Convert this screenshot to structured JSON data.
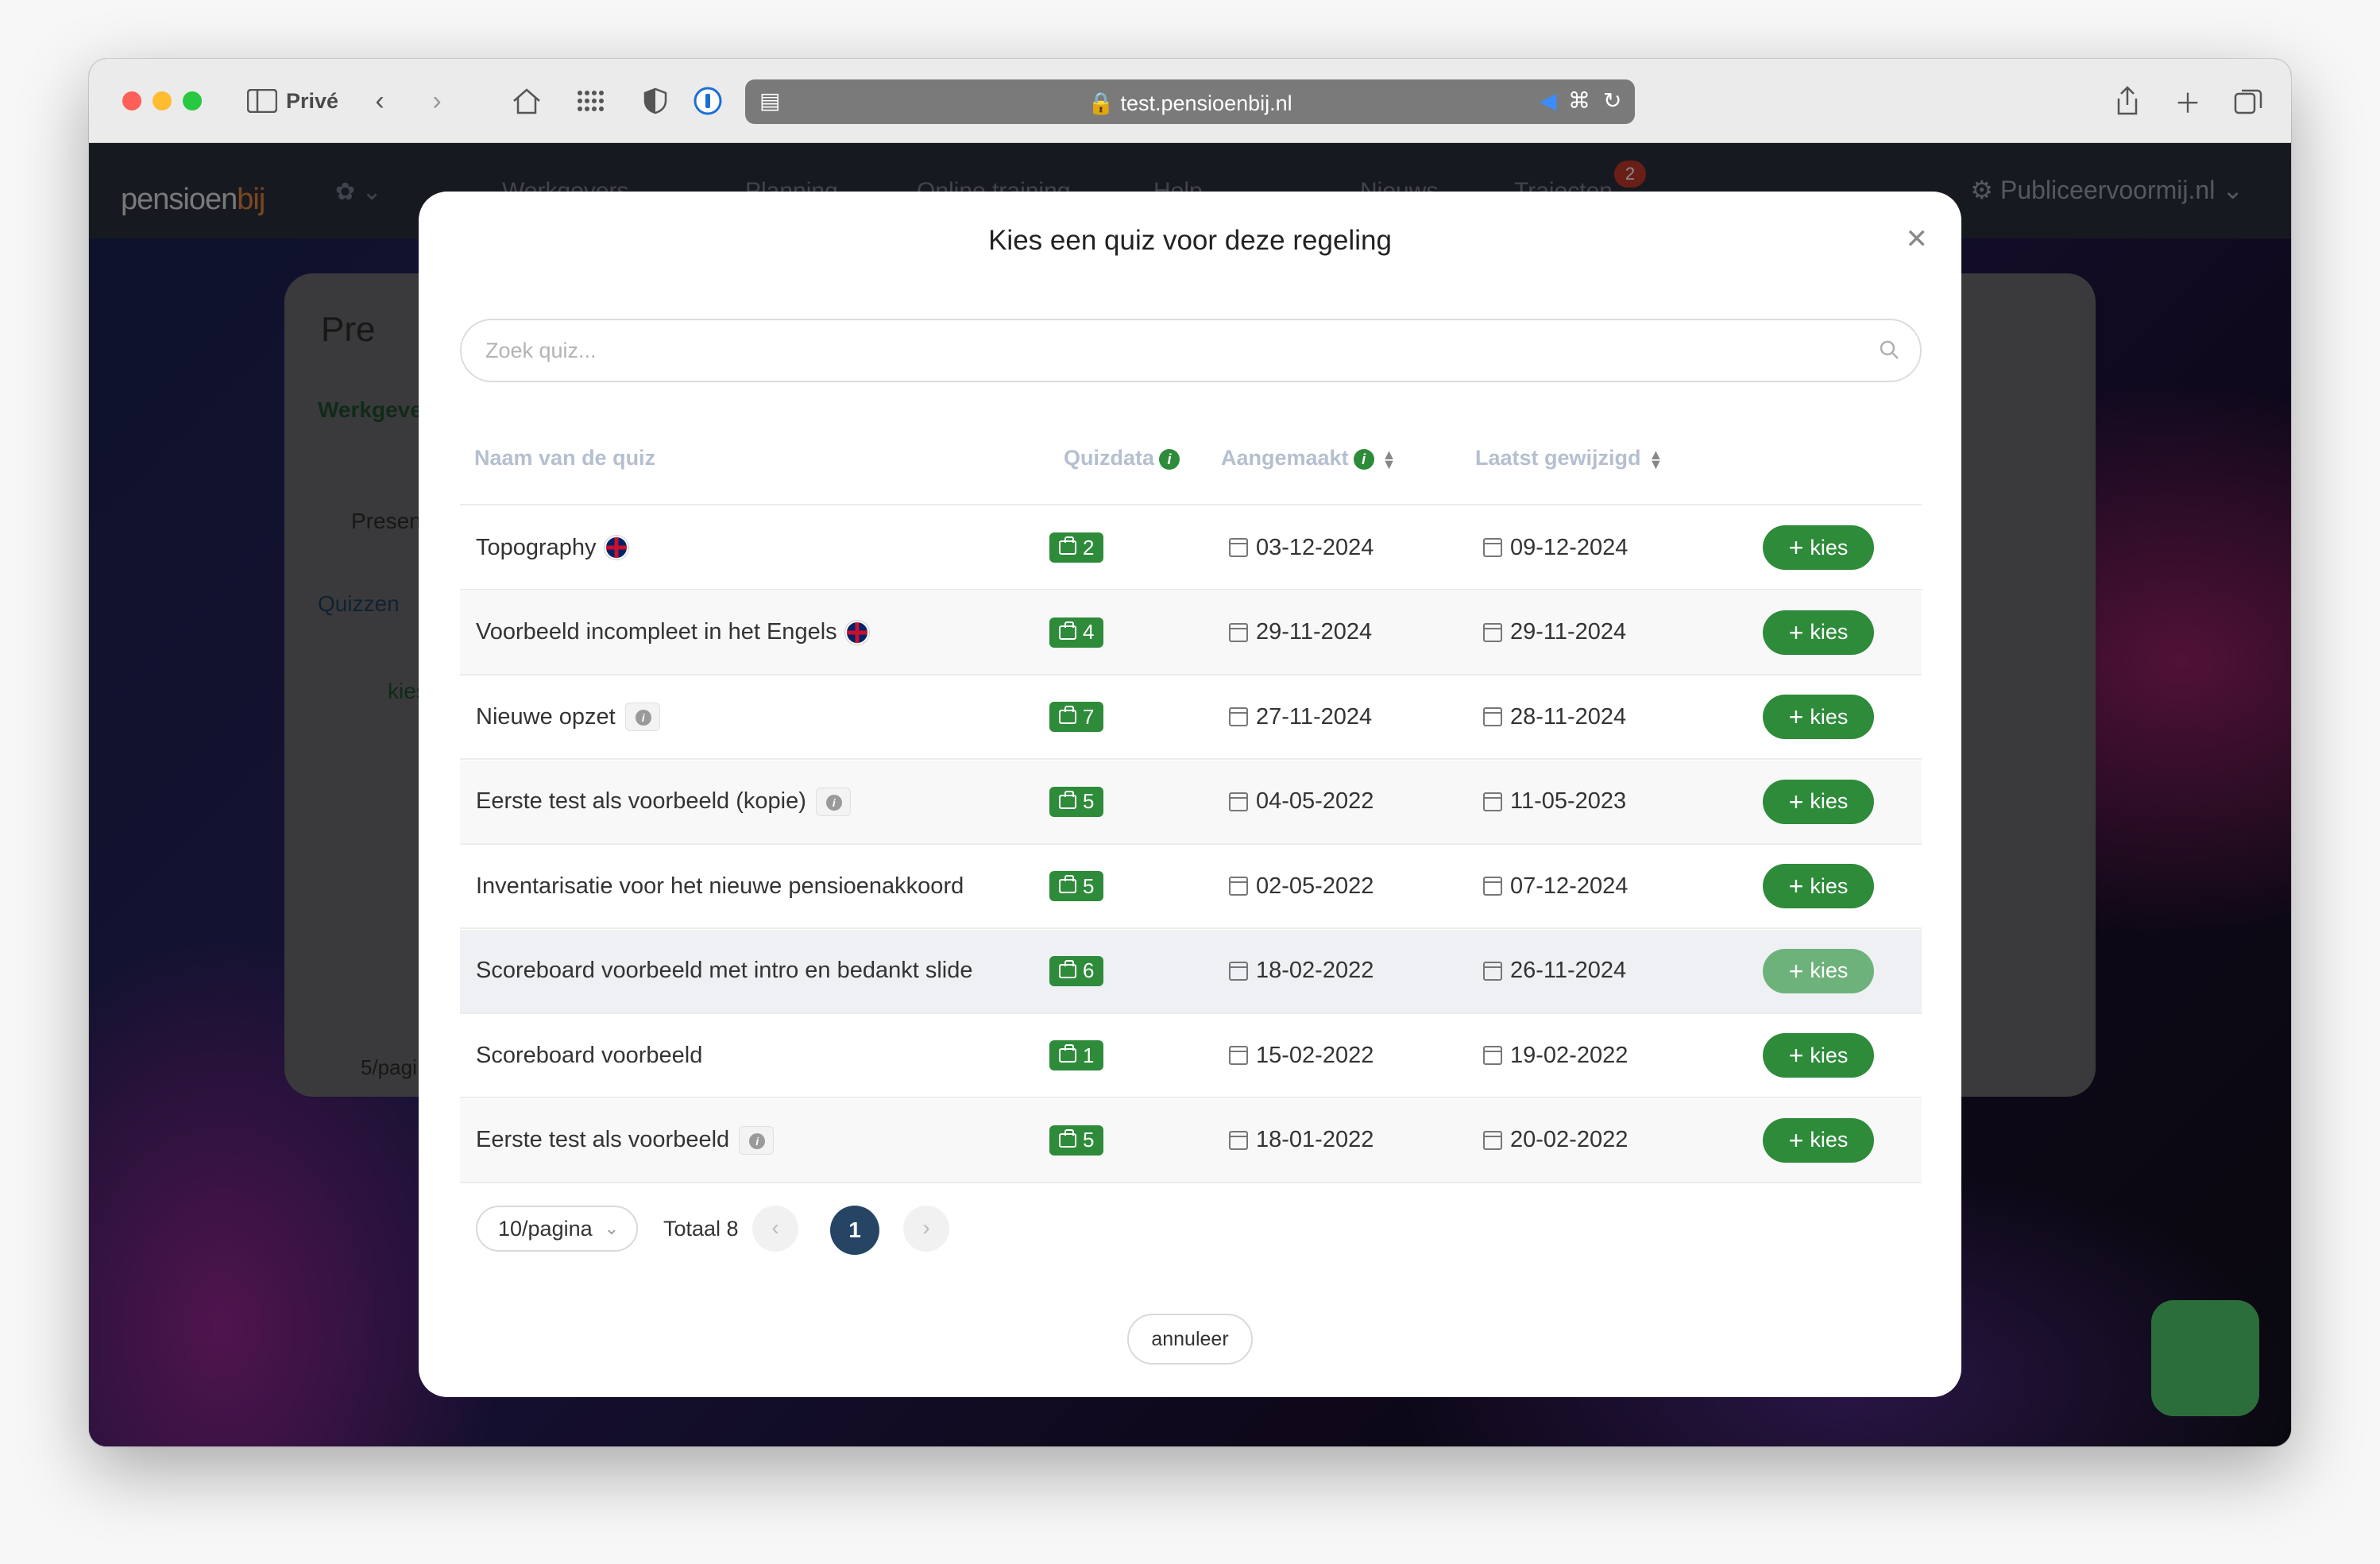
{
  "browser": {
    "profile_label": "Privé",
    "url": "test.pensioenbij.nl"
  },
  "app": {
    "logo_main": "pensioen",
    "logo_accent": "bij",
    "nav_items": [
      "Werkgevers",
      "Planning",
      "Online training",
      "Help",
      "Nieuws",
      "Trajecten"
    ],
    "notification_count": "2",
    "org_label": "Publiceervoormij.nl"
  },
  "background": {
    "title": "Pre",
    "werkgever_label": "Werkgeve",
    "presen_label": "Presen",
    "quizzen_tab": "Quizzen",
    "kies_label": "kies",
    "per_page": "5/pagi"
  },
  "modal": {
    "title": "Kies een quiz voor deze regeling",
    "search_placeholder": "Zoek quiz...",
    "columns": {
      "name": "Naam van de quiz",
      "quizdata": "Quizdata",
      "aangemaakt": "Aangemaakt",
      "laatst": "Laatst gewijzigd"
    },
    "rows": [
      {
        "name": "Topography",
        "count": "2",
        "created": "03-12-2024",
        "modified": "09-12-2024"
      },
      {
        "name": "Voorbeeld incompleet in het Engels",
        "count": "4",
        "created": "29-11-2024",
        "modified": "29-11-2024"
      },
      {
        "name": "Nieuwe opzet",
        "count": "7",
        "created": "27-11-2024",
        "modified": "28-11-2024"
      },
      {
        "name": "Eerste test als voorbeeld (kopie)",
        "count": "5",
        "created": "04-05-2022",
        "modified": "11-05-2023"
      },
      {
        "name": "Inventarisatie voor het nieuwe pensioenakkoord",
        "count": "5",
        "created": "02-05-2022",
        "modified": "07-12-2024"
      },
      {
        "name": "Scoreboard voorbeeld met intro en bedankt slide",
        "count": "6",
        "created": "18-02-2022",
        "modified": "26-11-2024"
      },
      {
        "name": "Scoreboard voorbeeld",
        "count": "1",
        "created": "15-02-2022",
        "modified": "19-02-2022"
      },
      {
        "name": "Eerste test als voorbeeld",
        "count": "5",
        "created": "18-01-2022",
        "modified": "20-02-2022"
      }
    ],
    "kies_label": "kies",
    "pagination": {
      "per_page": "10/pagina",
      "total": "Totaal 8",
      "current_page": "1"
    },
    "cancel_label": "annuleer"
  },
  "colors": {
    "accent_green": "#2e8b3a",
    "page_active": "#264565"
  }
}
